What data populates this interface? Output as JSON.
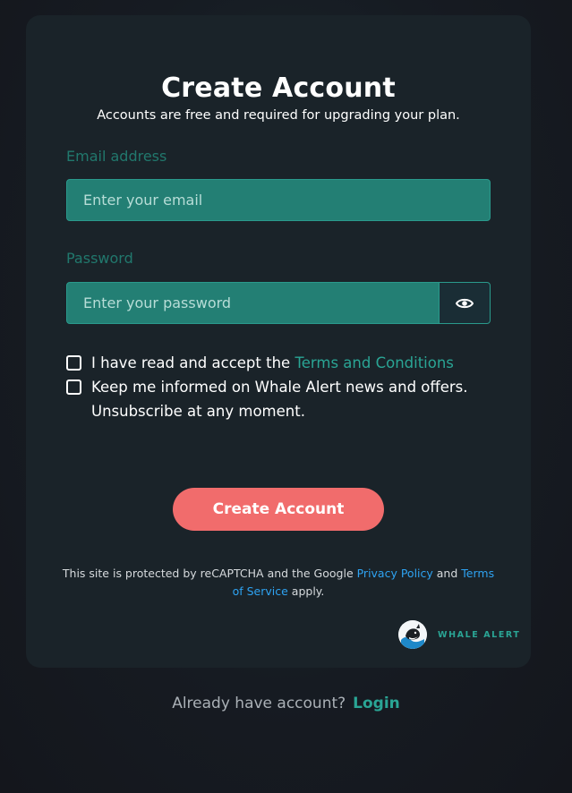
{
  "form": {
    "title": "Create Account",
    "subtitle": "Accounts are free and required for upgrading your plan.",
    "email_label": "Email address",
    "email_placeholder": "Enter your email",
    "email_value": "",
    "password_label": "Password",
    "password_placeholder": "Enter your password",
    "password_value": "",
    "password_toggle_icon": "eye-icon",
    "terms_checkbox": {
      "text": "I have read and accept the ",
      "link": "Terms and Conditions",
      "checked": false
    },
    "news_checkbox": {
      "line1": "Keep me informed on Whale Alert news and offers.",
      "line2": "Unsubscribe at any moment.",
      "checked": false
    },
    "submit_label": "Create Account"
  },
  "recaptcha": {
    "text_before": "This site is protected by reCAPTCHA and the Google ",
    "privacy_link": "Privacy Policy",
    "and": " and ",
    "terms_link_1": "Terms",
    "terms_link_2": "of Service",
    "text_after": " apply."
  },
  "brand": {
    "name": "WHALE ALERT",
    "logo_icon": "whale-alert-logo"
  },
  "footer": {
    "prompt": "Already have account?",
    "login_label": "Login"
  },
  "colors": {
    "background": "#161b22",
    "card": "#1a2329",
    "input_fill": "#237f74",
    "accent_teal": "#2aa595",
    "button": "#f16c6c",
    "link_blue": "#2ea3f2"
  }
}
